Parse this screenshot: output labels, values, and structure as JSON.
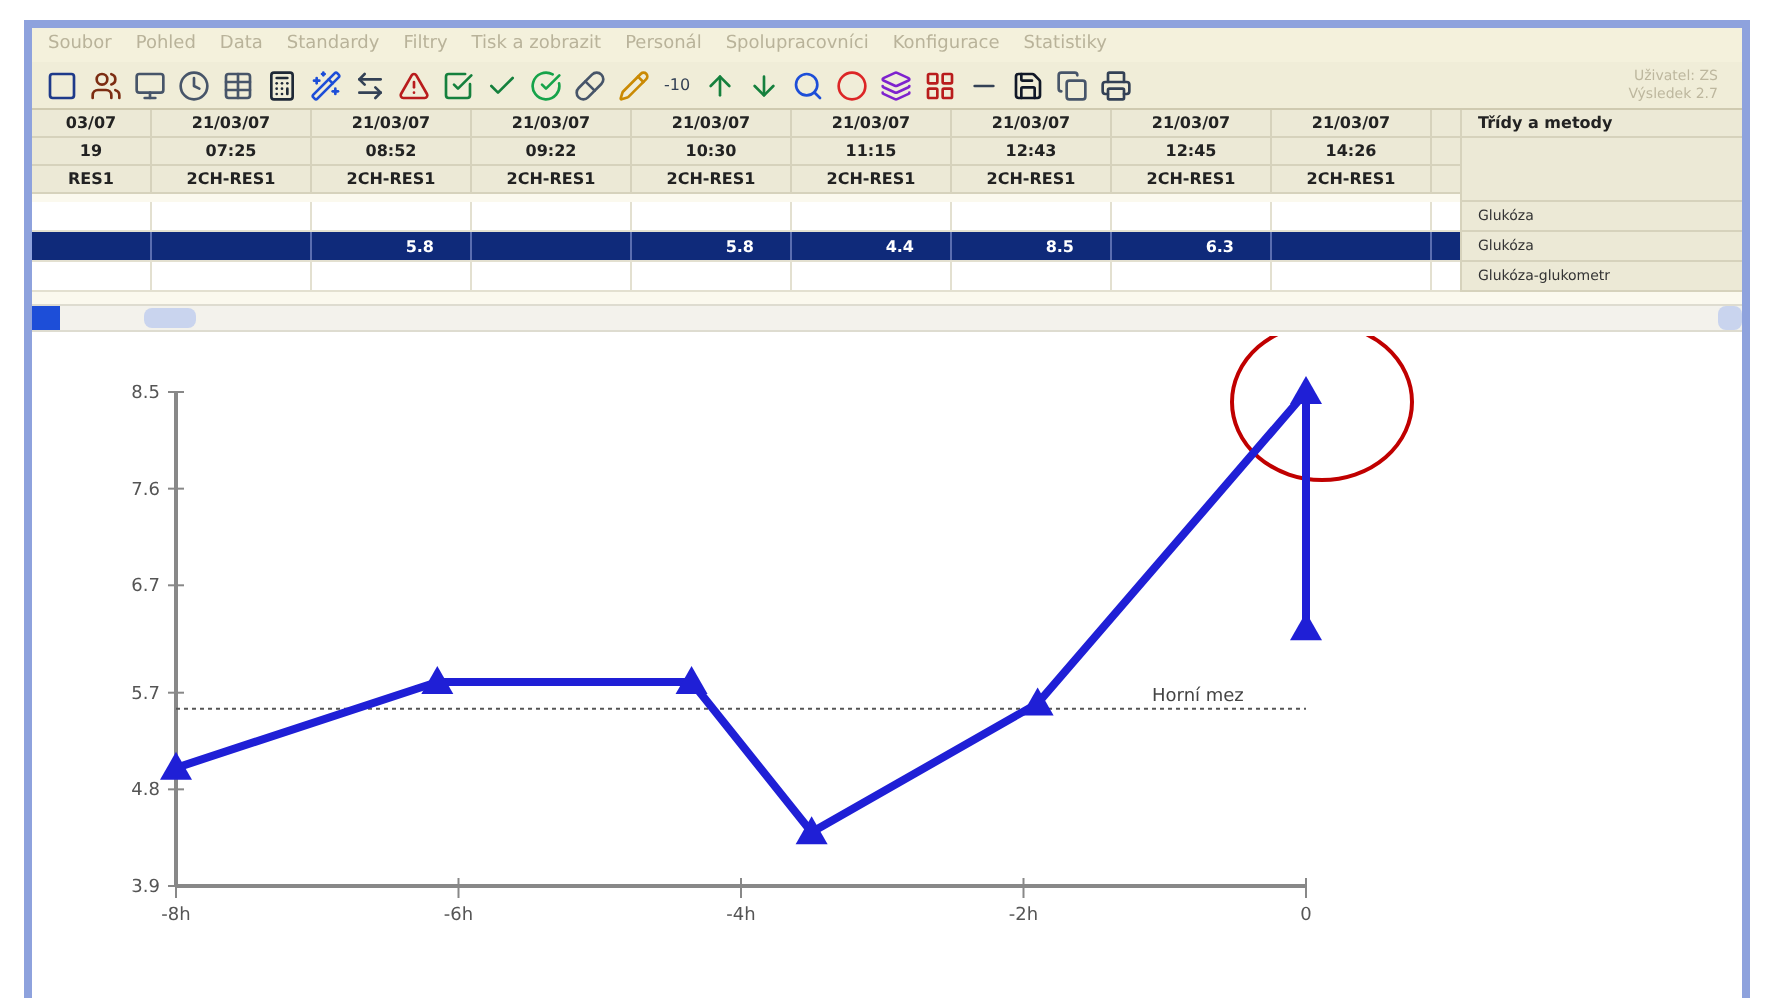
{
  "menu": [
    "Soubor",
    "Pohled",
    "Data",
    "Standardy",
    "Filtry",
    "Tisk a zobrazit",
    "Personál",
    "Spolupracovníci",
    "Konfigurace",
    "Statistiky"
  ],
  "toolbar_text": "-10",
  "user_info": [
    "Uživatel: ZS",
    "Výsledek 2.7"
  ],
  "table": {
    "columns": [
      {
        "date": "03/07",
        "time": "19",
        "code": "RES1"
      },
      {
        "date": "21/03/07",
        "time": "07:25",
        "code": "2CH-RES1"
      },
      {
        "date": "21/03/07",
        "time": "08:52",
        "code": "2CH-RES1",
        "glucose": "5.8"
      },
      {
        "date": "21/03/07",
        "time": "09:22",
        "code": "2CH-RES1"
      },
      {
        "date": "21/03/07",
        "time": "10:30",
        "code": "2CH-RES1",
        "glucose": "5.8"
      },
      {
        "date": "21/03/07",
        "time": "11:15",
        "code": "2CH-RES1",
        "glucose": "4.4"
      },
      {
        "date": "21/03/07",
        "time": "12:43",
        "code": "2CH-RES1",
        "glucose": "8.5"
      },
      {
        "date": "21/03/07",
        "time": "12:45",
        "code": "2CH-RES1",
        "glucose": "6.3"
      },
      {
        "date": "21/03/07",
        "time": "14:26",
        "code": "2CH-RES1"
      }
    ],
    "rows": [
      {
        "label": "Glukóza",
        "selected": false
      },
      {
        "label": "Glukóza",
        "selected": true
      },
      {
        "label": "Glukóza-glukometr",
        "selected": false
      }
    ],
    "side_header": "Třídy a metody"
  },
  "chart": {
    "chart_data": {
      "type": "line",
      "x": [
        -8,
        -6.15,
        -4.35,
        -3.5,
        -1.9,
        0,
        0
      ],
      "series": [
        {
          "color": "#1f1fd6",
          "marker": "triangle",
          "values": [
            5.0,
            5.8,
            5.8,
            4.4,
            5.6,
            8.5,
            6.3
          ]
        }
      ],
      "xlim": [
        -8,
        0
      ],
      "ylim": [
        3.9,
        8.5
      ],
      "xticks": [
        {
          "value": -8,
          "label": "-8h"
        },
        {
          "value": -6,
          "label": "-6h"
        },
        {
          "value": -4,
          "label": "-4h"
        },
        {
          "value": -2,
          "label": "-2h"
        },
        {
          "value": 0,
          "label": "0"
        }
      ],
      "yticks": [
        {
          "value": 3.9,
          "label": "3.9"
        },
        {
          "value": 4.8,
          "label": "4.8"
        },
        {
          "value": 5.7,
          "label": "5.7"
        },
        {
          "value": 6.7,
          "label": "6.7"
        },
        {
          "value": 7.6,
          "label": "7.6"
        },
        {
          "value": 8.5,
          "label": "8.5"
        }
      ],
      "ref_lines": [
        {
          "axis": "y",
          "value": 5.55,
          "label": "Horní mez"
        }
      ]
    }
  }
}
